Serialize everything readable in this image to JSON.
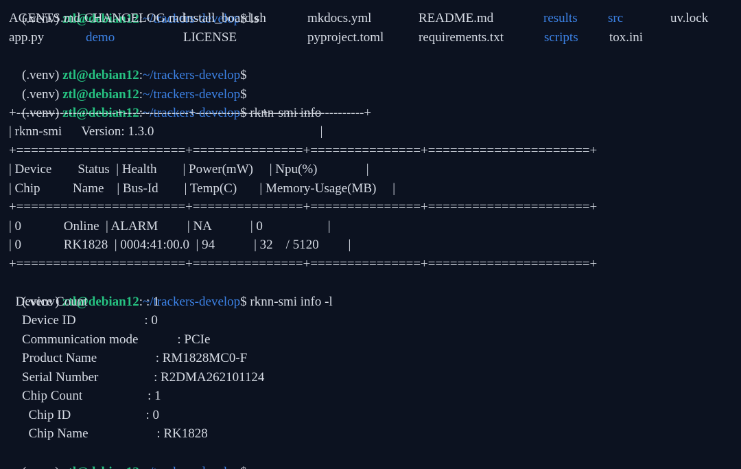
{
  "top_partial": {
    "venv": "(.venv) ",
    "user": "ztl@debian12",
    "colon": ":",
    "path": "~/trackers-develop",
    "dollar": "$ ",
    "cmd": "ls"
  },
  "ls_output": {
    "row1": [
      {
        "text": "AGENTS.md",
        "type": "file"
      },
      {
        "text": "CHANGELOG.md",
        "type": "file"
      },
      {
        "text": "install_board.sh",
        "type": "file"
      },
      {
        "text": "mkdocs.yml",
        "type": "file"
      },
      {
        "text": "README.md",
        "type": "file"
      },
      {
        "text": "results",
        "type": "dir"
      },
      {
        "text": "src",
        "type": "dir"
      },
      {
        "text": "uv.lock",
        "type": "file"
      }
    ],
    "row2": [
      {
        "text": "app.py",
        "type": "file"
      },
      {
        "text": "demo",
        "type": "dir"
      },
      {
        "text": "LICENSE",
        "type": "file"
      },
      {
        "text": "pyproject.toml",
        "type": "file"
      },
      {
        "text": "requirements.txt",
        "type": "file"
      },
      {
        "text": "scripts",
        "type": "dir"
      },
      {
        "text": "tox.ini",
        "type": "file"
      }
    ]
  },
  "prompt": {
    "venv": "(.venv) ",
    "user": "ztl@debian12",
    "colon": ":",
    "path": "~/trackers-develop",
    "dollar": "$"
  },
  "commands": {
    "info": " rknn-smi info",
    "info_l": " rknn-smi info -l"
  },
  "table": {
    "border": "+-----------------------+---------------+---------------+----------------------+",
    "double_border": "+=======================+===============+===============+======================+",
    "title_row": "| rknn-smi      Version: 1.3.0                                                   |",
    "header_row1": "| Device        Status  | Health        | Power(mW)     | Npu(%)               |",
    "header_row2": "| Chip          Name    | Bus-Id        | Temp(C)       | Memory-Usage(MB)     |",
    "data_row1": "| 0             Online  | ALARM         | NA            | 0                    |",
    "data_row2": "| 0             RK1828  | 0004:41:00.0  | 94            | 32    / 5120         |"
  },
  "info_l": {
    "device_count": "  Device Count                  : 1",
    "device_id": "    Device ID                     : 0",
    "comm_mode": "    Communication mode            : PCIe",
    "product_name": "    Product Name                  : RM1828MC0-F",
    "serial_number": "    Serial Number                 : R2DMA262101124",
    "chip_count": "    Chip Count                    : 1",
    "chip_id": "      Chip ID                       : 0",
    "chip_name": "      Chip Name                     : RK1828"
  }
}
